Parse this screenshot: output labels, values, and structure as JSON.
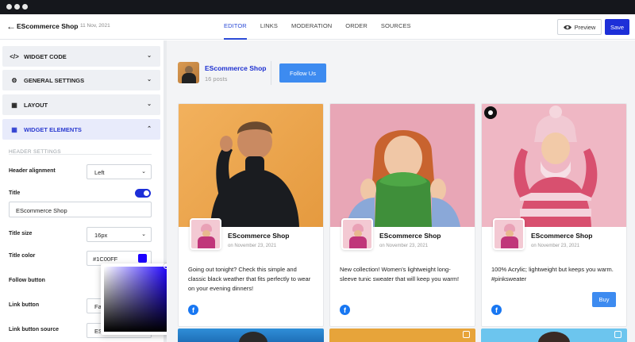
{
  "topbar": {
    "back_icon": "arrow-left-icon",
    "shop_name": "EScommerce Shop",
    "date": "11 Nov, 2021",
    "tabs": [
      "EDITOR",
      "LINKS",
      "MODERATION",
      "ORDER",
      "SOURCES"
    ],
    "active_tab": "EDITOR",
    "preview_label": "Preview",
    "save_label": "Save",
    "accent_color": "#1d2fd8"
  },
  "sidebar": {
    "sections": [
      {
        "icon": "code-icon",
        "label": "WIDGET CODE"
      },
      {
        "icon": "gear-icon",
        "label": "GENERAL SETTINGS"
      },
      {
        "icon": "layout-icon",
        "label": "LAYOUT"
      },
      {
        "icon": "grid-icon",
        "label": "WIDGET ELEMENTS"
      }
    ],
    "open_section": "WIDGET ELEMENTS",
    "header_settings_label": "HEADER SETTINGS",
    "fields": {
      "header_alignment": {
        "label": "Header alignment",
        "value": "Left"
      },
      "title": {
        "label": "Title",
        "enabled": true,
        "value": "EScommerce Shop"
      },
      "title_size": {
        "label": "Title size",
        "value": "16px"
      },
      "title_color": {
        "label": "Title color",
        "value": "#1C00FF",
        "swatch": "#1c00ff"
      },
      "follow_button": {
        "label": "Follow button"
      },
      "link_button": {
        "label": "Link button",
        "value": "Fa"
      },
      "link_button_source": {
        "label": "Link button source",
        "value": "ES"
      }
    }
  },
  "feed": {
    "header": {
      "name": "EScommerce Shop",
      "posts": "16 posts",
      "follow_label": "Follow Us"
    },
    "cards": [
      {
        "name": "EScommerce Shop",
        "date": "on November 23, 2021",
        "text": "Going out tonight? Check this simple and classic black weather that fits perfectly to wear on your evening dinners!",
        "has_buy": false,
        "has_insta": false
      },
      {
        "name": "EScommerce Shop",
        "date": "on November 23, 2021",
        "text": "New collection! Women's lightweight long-sleeve tunic sweater that will keep you warm!",
        "has_buy": false,
        "has_insta": false
      },
      {
        "name": "EScommerce Shop",
        "date": "on November 23, 2021",
        "text": "100% Acrylic; lightweight but keeps you warm. #pinksweater",
        "has_buy": true,
        "buy_label": "Buy",
        "has_insta": true
      }
    ]
  }
}
